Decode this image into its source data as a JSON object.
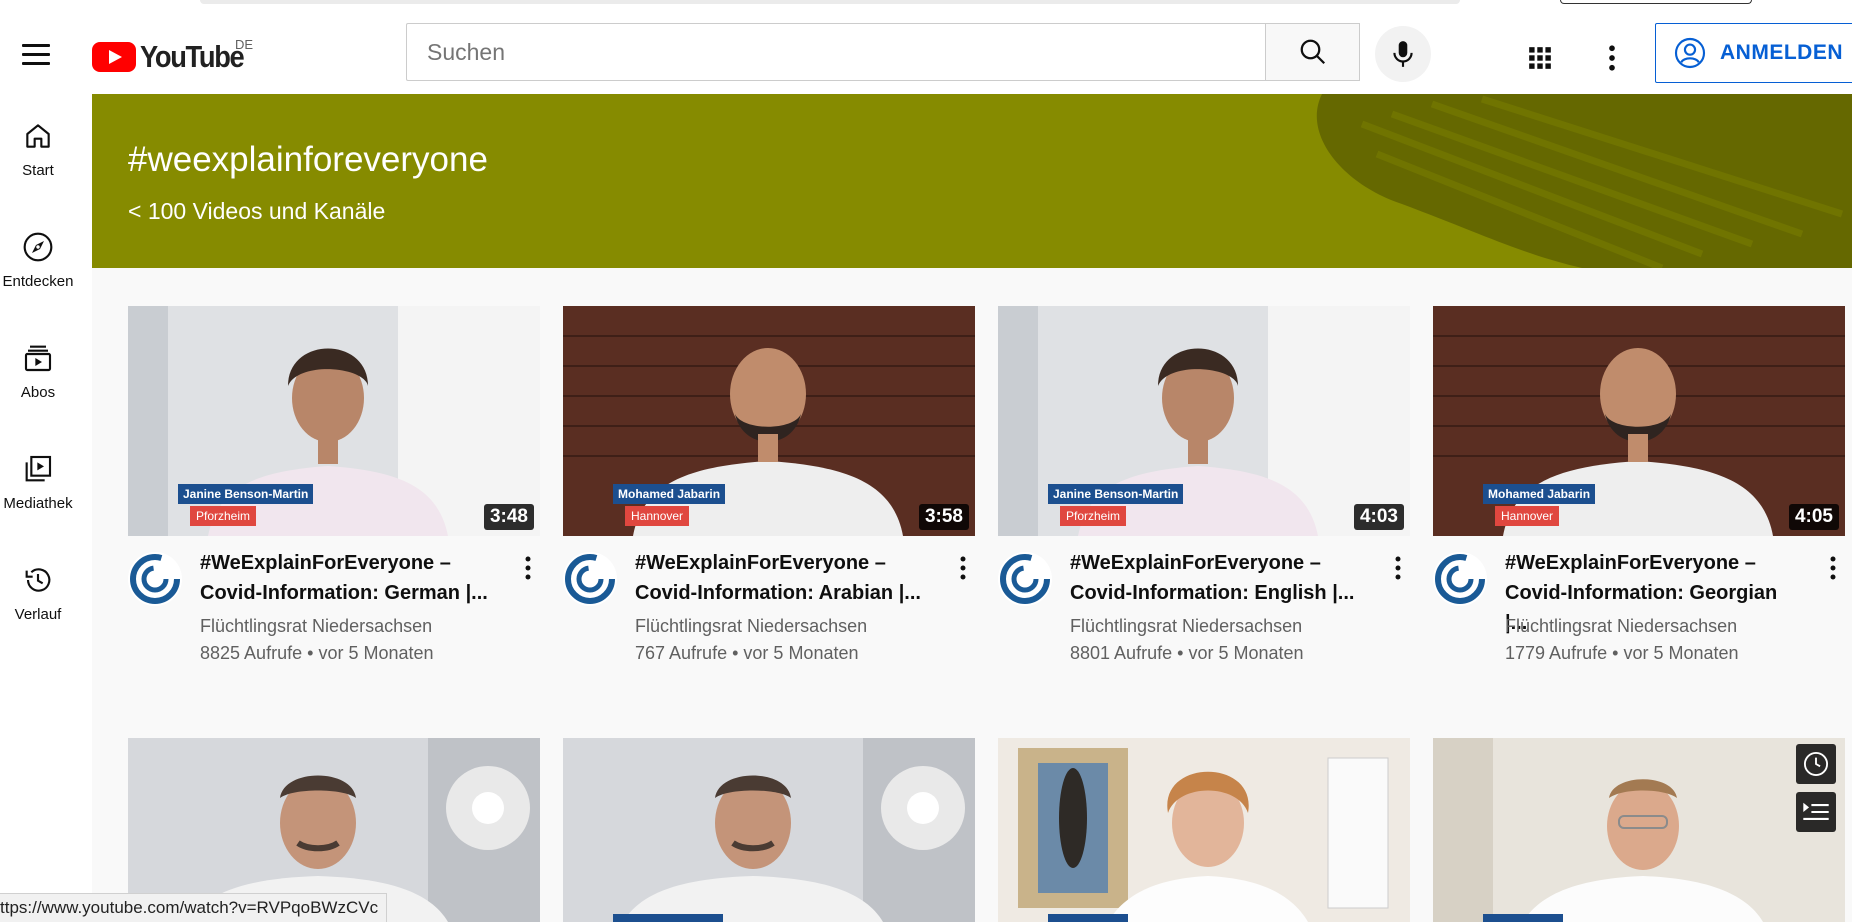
{
  "header": {
    "logo_text": "YouTube",
    "country_code": "DE",
    "search_placeholder": "Suchen",
    "signin_label": "ANMELDEN",
    "icons": [
      "menu-icon",
      "search-icon",
      "mic-icon",
      "apps-grid-icon",
      "more-vert-icon",
      "account-icon"
    ]
  },
  "sidebar": {
    "items": [
      {
        "label": "Start",
        "icon": "home-icon"
      },
      {
        "label": "Entdecken",
        "icon": "compass-icon"
      },
      {
        "label": "Abos",
        "icon": "subscriptions-icon"
      },
      {
        "label": "Mediathek",
        "icon": "library-icon"
      },
      {
        "label": "Verlauf",
        "icon": "history-icon"
      }
    ]
  },
  "banner": {
    "title": "#weexplainforeveryone",
    "subtitle": "< 100 Videos und Kanäle",
    "color": "#868b00"
  },
  "videos": [
    {
      "title": "#WeExplainForEveryone –\nCovid-Information: German |...",
      "channel": "Flüchtlingsrat Niedersachsen",
      "views": "8825 Aufrufe",
      "age": "vor 5 Monaten",
      "duration": "3:48",
      "name_tag": "Janine Benson-Martin",
      "city_tag": "Pforzheim"
    },
    {
      "title": "#WeExplainForEveryone –\nCovid-Information: Arabian |...",
      "channel": "Flüchtlingsrat Niedersachsen",
      "views": "767 Aufrufe",
      "age": "vor 5 Monaten",
      "duration": "3:58",
      "name_tag": "Mohamed Jabarin",
      "city_tag": "Hannover"
    },
    {
      "title": "#WeExplainForEveryone –\nCovid-Information: English |...",
      "channel": "Flüchtlingsrat Niedersachsen",
      "views": "8801 Aufrufe",
      "age": "vor 5 Monaten",
      "duration": "4:03",
      "name_tag": "Janine Benson-Martin",
      "city_tag": "Pforzheim"
    },
    {
      "title": "#WeExplainForEveryone –\nCovid-Information: Georgian |...",
      "channel": "Flüchtlingsrat Niedersachsen",
      "views": "1779 Aufrufe",
      "age": "vor 5 Monaten",
      "duration": "4:05",
      "name_tag": "Mohamed Jabarin",
      "city_tag": "Hannover"
    }
  ],
  "meta_separator": "•",
  "overlay_buttons": [
    "watch-later-icon",
    "add-to-queue-icon"
  ],
  "status_url": "ttps://www.youtube.com/watch?v=RVPqoBWzCVc"
}
